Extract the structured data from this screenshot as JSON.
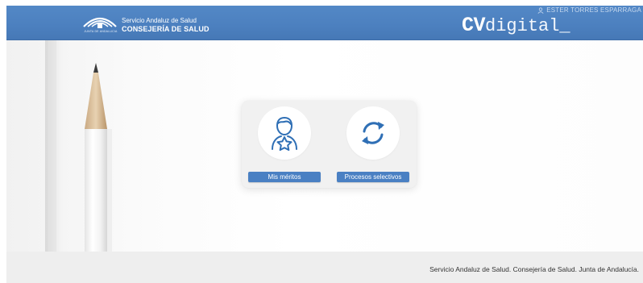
{
  "header": {
    "brand_caption": "JUNTA DE ANDALUCIA",
    "brand_line1": "Servicio Andaluz de Salud",
    "brand_line2": "CONSEJERÍA DE SALUD",
    "user_name": "ESTER TORRES ESPARRAGA",
    "app_logo_bold": "CV",
    "app_logo_light": "digital_"
  },
  "main": {
    "cards": [
      {
        "label": "Mis méritos",
        "icon": "user-star-icon"
      },
      {
        "label": "Procesos selectivos",
        "icon": "refresh-cycle-icon"
      }
    ]
  },
  "footer": {
    "text": "Servicio Andaluz de Salud. Consejería de Salud. Junta de Andalucía."
  },
  "colors": {
    "header_blue": "#4c80bf",
    "button_blue": "#4a80c3",
    "icon_blue": "#2f6fb5",
    "card_bg": "#f1f1f1",
    "footer_bg": "#eeeeee"
  }
}
